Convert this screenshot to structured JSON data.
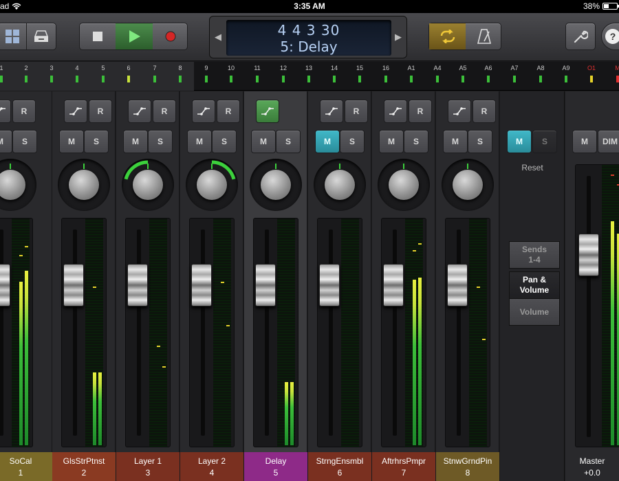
{
  "status": {
    "carrier": "ad",
    "time": "3:35 AM",
    "battery": "38%"
  },
  "lcd": {
    "position": "4 4 3   30",
    "track": "5: Delay"
  },
  "ruler": {
    "numbers": [
      "1",
      "2",
      "3",
      "4",
      "5",
      "6",
      "7",
      "8",
      "9",
      "10",
      "11",
      "12",
      "13",
      "14",
      "15",
      "16",
      "A1",
      "A4",
      "A5",
      "A6",
      "A7",
      "A8",
      "A9",
      "O1",
      "M"
    ]
  },
  "strips": [
    {
      "name": "SoCal",
      "number": "1",
      "color": "#7a6a28",
      "auto_label": "",
      "read_label": "R",
      "mute": "M",
      "solo": "S",
      "mute_on": false
    },
    {
      "name": "GlsStrPtnst",
      "number": "2",
      "color": "#8a3a22",
      "auto_label": "",
      "read_label": "R",
      "mute": "M",
      "solo": "S",
      "mute_on": false
    },
    {
      "name": "Layer 1",
      "number": "3",
      "color": "#7a3020",
      "auto_label": "",
      "read_label": "R",
      "mute": "M",
      "solo": "S",
      "mute_on": false
    },
    {
      "name": "Layer 2",
      "number": "4",
      "color": "#7a3020",
      "auto_label": "",
      "read_label": "R",
      "mute": "M",
      "solo": "S",
      "mute_on": false
    },
    {
      "name": "Delay",
      "number": "5",
      "color": "#8e2a88",
      "auto_label": "",
      "read_label": "",
      "mute": "M",
      "solo": "S",
      "mute_on": false
    },
    {
      "name": "StrngEnsmbl",
      "number": "6",
      "color": "#7a3020",
      "auto_label": "",
      "read_label": "R",
      "mute": "M",
      "solo": "S",
      "mute_on": true
    },
    {
      "name": "AftrhrsPmpr",
      "number": "7",
      "color": "#7a3020",
      "auto_label": "",
      "read_label": "R",
      "mute": "M",
      "solo": "S",
      "mute_on": false
    },
    {
      "name": "StnwGrndPin",
      "number": "8",
      "color": "#6e5a26",
      "auto_label": "",
      "read_label": "R",
      "mute": "M",
      "solo": "S",
      "mute_on": false
    }
  ],
  "panel": {
    "mute": "M",
    "solo": "S",
    "reset": "Reset",
    "tab1": "Sends\n1-4",
    "tab2": "Pan &\nVolume",
    "tab3": "Volume"
  },
  "master": {
    "mute": "M",
    "dim": "DIM",
    "name": "Master",
    "value": "+0.0"
  }
}
